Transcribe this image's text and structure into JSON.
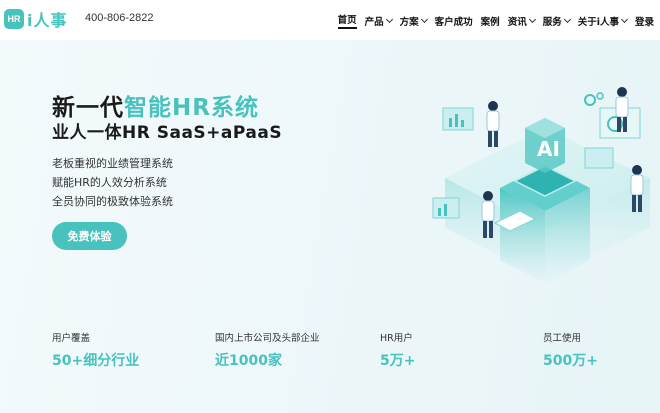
{
  "header": {
    "logo_badge": "HR",
    "logo_text": "i人事",
    "phone": "400-806-2822",
    "nav": [
      {
        "label": "首页",
        "dropdown": false,
        "active": true
      },
      {
        "label": "产品",
        "dropdown": true,
        "active": false
      },
      {
        "label": "方案",
        "dropdown": true,
        "active": false
      },
      {
        "label": "客户成功",
        "dropdown": false,
        "active": false
      },
      {
        "label": "案例",
        "dropdown": false,
        "active": false
      },
      {
        "label": "资讯",
        "dropdown": true,
        "active": false
      },
      {
        "label": "服务",
        "dropdown": true,
        "active": false
      },
      {
        "label": "关于i人事",
        "dropdown": true,
        "active": false
      },
      {
        "label": "登录",
        "dropdown": false,
        "active": false
      }
    ]
  },
  "hero": {
    "title_plain": "新一代",
    "title_highlight": "智能HR系统",
    "subtitle": "业人一体HR SaaS+aPaaS",
    "features": [
      "老板重视的业绩管理系统",
      "赋能HR的人效分析系统",
      "全员协同的极致体验系统"
    ],
    "cta_label": "免费体验",
    "illustration_badge": "AI"
  },
  "stats": [
    {
      "label": "用户覆盖",
      "value": "50+细分行业"
    },
    {
      "label": "国内上市公司及头部企业",
      "value": "近1000家"
    },
    {
      "label": "HR用户",
      "value": "5万+"
    },
    {
      "label": "员工使用",
      "value": "500万+"
    }
  ],
  "colors": {
    "accent": "#48c2bd",
    "text": "#1a1a1a"
  }
}
